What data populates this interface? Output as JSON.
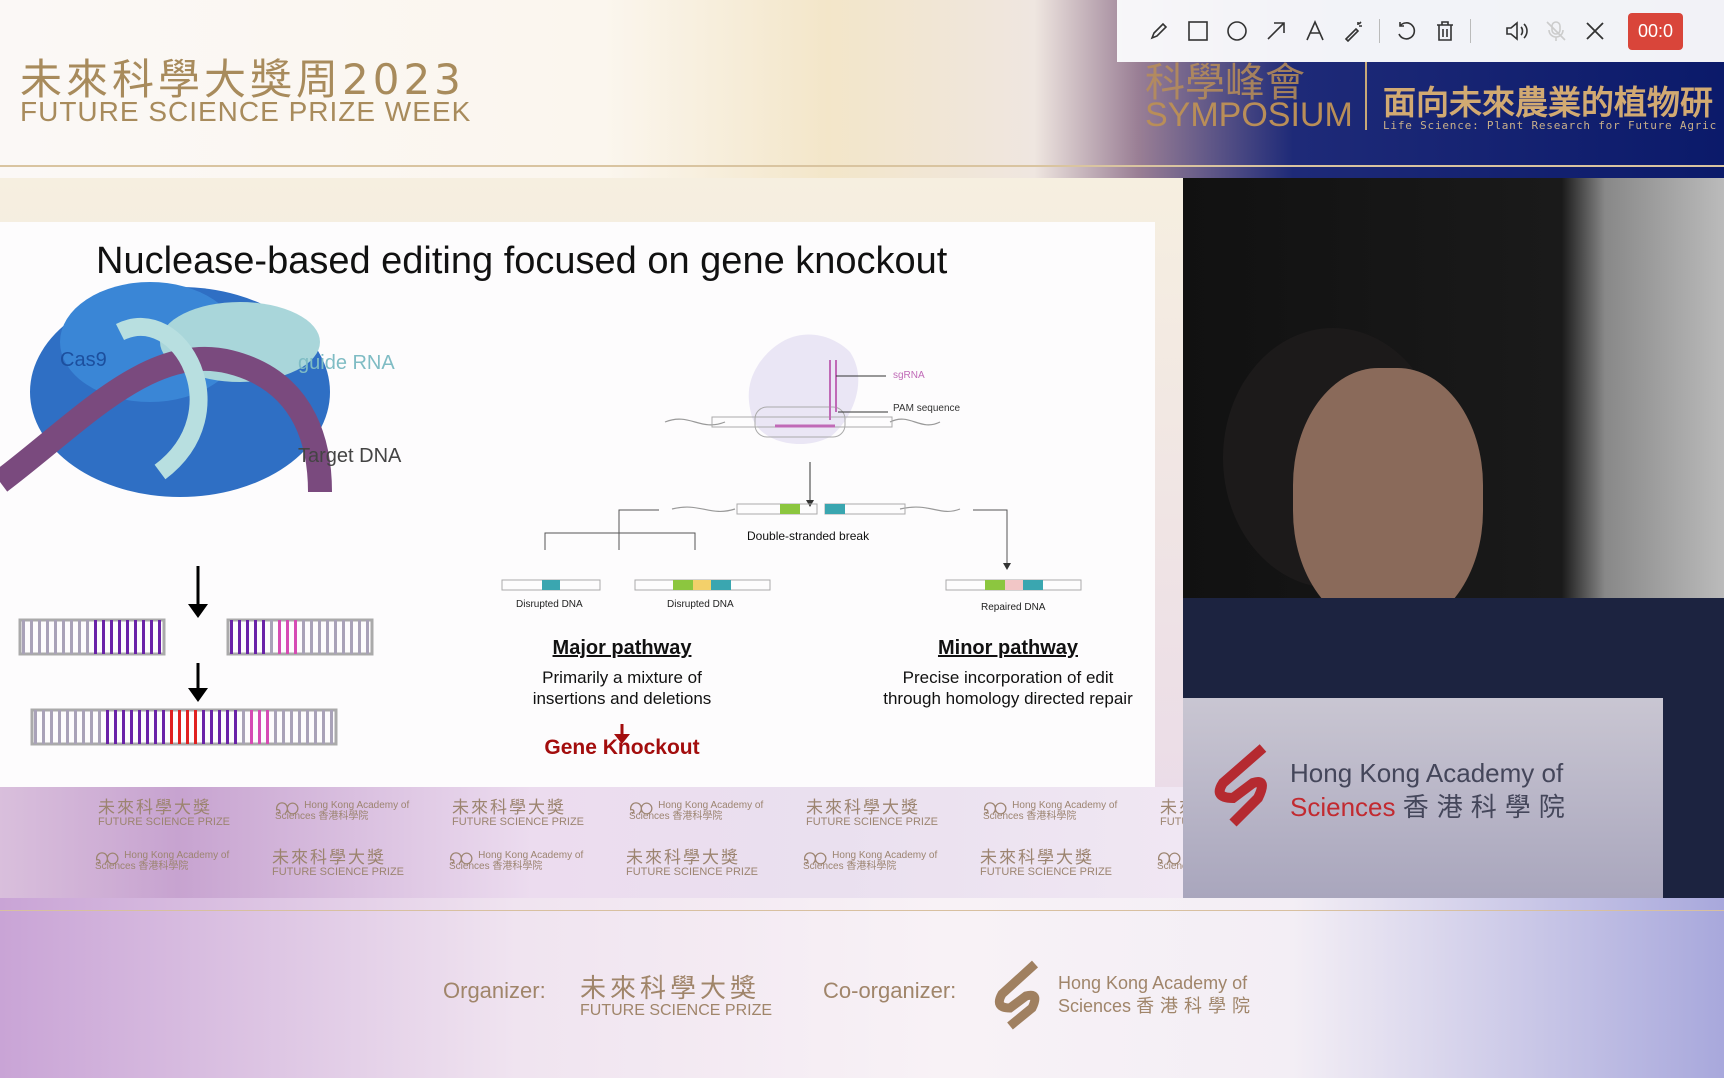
{
  "header": {
    "event_cn": "未來科學大獎周2023",
    "event_en": "FUTURE SCIENCE PRIZE WEEK",
    "symposium_cn": "科學峰會",
    "symposium_en": "SYMPOSIUM",
    "subtitle_cn": "面向未來農業的植物研",
    "subtitle_en": "Life Science: Plant Research for Future Agric"
  },
  "toolbar": {
    "tools": [
      "pencil-icon",
      "rectangle-icon",
      "circle-icon",
      "arrow-icon",
      "text-icon",
      "magic-wand-icon",
      "undo-icon",
      "trash-icon",
      "speaker-icon",
      "mic-muted-icon",
      "close-icon"
    ],
    "timer": "00:0"
  },
  "slide": {
    "title": "Nuclease-based editing focused on gene knockout",
    "labels": {
      "cas9": "Cas9",
      "guide_rna": "guide RNA",
      "target_dna": "Target DNA"
    },
    "diagram": {
      "sgrna": "sgRNA",
      "pam": "PAM sequence",
      "dsb": "Double-stranded break",
      "disrupted1": "Disrupted DNA",
      "disrupted2": "Disrupted DNA",
      "repaired": "Repaired DNA"
    },
    "major": {
      "title": "Major pathway",
      "line1": "Primarily a mixture of",
      "line2": "insertions and deletions",
      "result": "Gene Knockout"
    },
    "minor": {
      "title": "Minor pathway",
      "line1": "Precise incorporation of edit",
      "line2": "through homology directed repair"
    },
    "colors": {
      "result": "#a30d0d",
      "dna_purple": "#6a22a8",
      "dna_magenta": "#d64bb4",
      "cut_red": "#e02020"
    }
  },
  "strip": {
    "fsp_cn": "未來科學大獎",
    "fsp_en": "FUTURE SCIENCE PRIZE",
    "hkas_en1": "Hong Kong Academy of",
    "hkas_en2": "Sciences",
    "hkas_cn": "香港科學院"
  },
  "video": {
    "podium_en1": "Hong Kong Academy of",
    "podium_en2": "Sciences",
    "podium_cn": "香港科學院"
  },
  "footer": {
    "organizer_label": "Organizer:",
    "organizer_cn": "未來科學大獎",
    "organizer_en": "FUTURE SCIENCE PRIZE",
    "coorganizer_label": "Co-organizer:",
    "co_en1": "Hong Kong Academy of",
    "co_en2": "Sciences",
    "co_cn": "香港科學院"
  }
}
